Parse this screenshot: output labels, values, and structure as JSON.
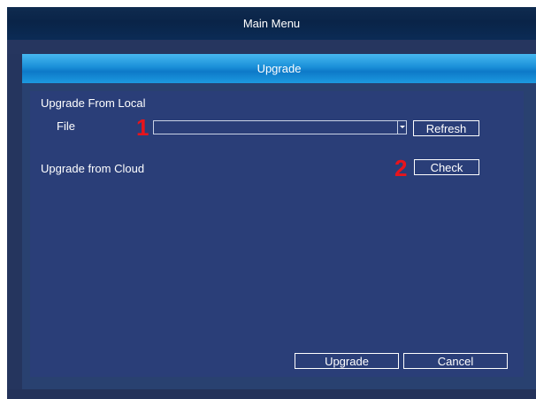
{
  "main_menu": {
    "title": "Main Menu"
  },
  "dialog": {
    "title": "Upgrade",
    "local": {
      "heading": "Upgrade From Local",
      "file_label": "File",
      "file_value": "",
      "refresh_label": "Refresh"
    },
    "cloud": {
      "heading": "Upgrade from Cloud",
      "check_label": "Check"
    },
    "annotations": {
      "first": "1",
      "second": "2"
    },
    "buttons": {
      "upgrade": "Upgrade",
      "cancel": "Cancel"
    }
  },
  "colors": {
    "annotation_red": "#e8141c",
    "title_blue": "#1a8fd8",
    "panel_navy": "#2a3e78"
  },
  "icons": {
    "dropdown": "chevron-down-icon"
  }
}
